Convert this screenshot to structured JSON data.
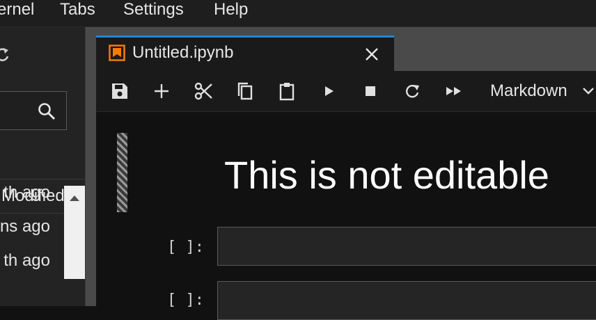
{
  "menubar": {
    "items": [
      "ernel",
      "Tabs",
      "Settings",
      "Help"
    ]
  },
  "file_browser": {
    "column_modified": "Modified",
    "items": [
      {
        "modified": "th ago"
      },
      {
        "modified": "ns ago"
      },
      {
        "modified": "th ago"
      }
    ]
  },
  "tabs": [
    {
      "title": "Untitled.ipynb",
      "icon": "notebook-icon"
    }
  ],
  "toolbar": {
    "buttons": [
      "save-icon",
      "add-icon",
      "cut-icon",
      "copy-icon",
      "paste-icon",
      "run-icon",
      "stop-icon",
      "restart-icon",
      "fast-forward-icon"
    ],
    "cell_type": "Markdown"
  },
  "notebook": {
    "cells": [
      {
        "type": "markdown",
        "rendered": "This is not editable"
      },
      {
        "type": "code",
        "prompt": "[ ]:",
        "source": ""
      },
      {
        "type": "code",
        "prompt": "[ ]:",
        "source": ""
      }
    ]
  },
  "colors": {
    "accent": "#1f88d6",
    "notebook_icon": "#f57c00",
    "background": "#111111"
  }
}
